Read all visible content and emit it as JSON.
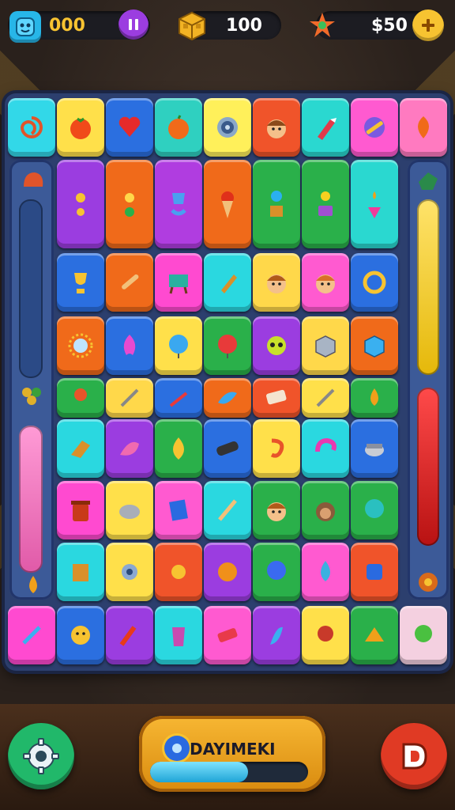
{
  "hud": {
    "moves_value": "000",
    "blocks_value": "100",
    "cash_value": "$50",
    "icons": {
      "left": "blue-cube-face-icon",
      "pause": "pause-icon",
      "blocks": "gold-block-icon",
      "cash": "star-burst-icon",
      "add": "plus-icon"
    }
  },
  "bottom": {
    "name_label": "DAYIMEKI",
    "progress": 0.62,
    "settings_icon": "gear-icon",
    "action_icon": "d-letter-icon"
  },
  "colors": {
    "accent_yellow": "#f7c331",
    "purple": "#9b3de0",
    "board": "#2c3f6e",
    "settings": "#21b86a",
    "action": "#e03a24"
  }
}
